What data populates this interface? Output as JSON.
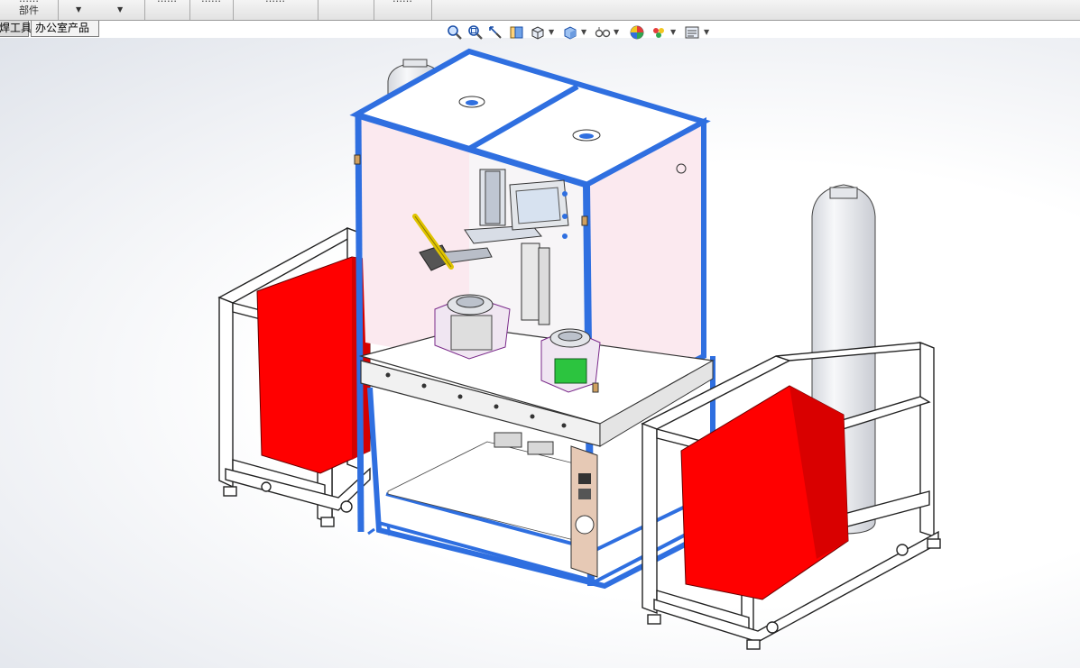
{
  "ribbon": {
    "assembly_label": "部件",
    "cut_labels": [
      "……",
      "……",
      "……",
      "……",
      "……"
    ]
  },
  "command_tabs": [
    {
      "label": "焊工具",
      "active": false
    },
    {
      "label": "办公室产品",
      "active": true
    }
  ],
  "heads_up_toolbar": [
    {
      "name": "zoom-to-fit-icon"
    },
    {
      "name": "zoom-to-area-icon"
    },
    {
      "name": "previous-view-icon"
    },
    {
      "name": "section-view-icon"
    },
    {
      "name": "view-orientation-icon",
      "dropdown": true
    },
    {
      "name": "display-style-icon",
      "dropdown": true
    },
    {
      "name": "hide-show-items-icon",
      "dropdown": true
    },
    {
      "name": "edit-appearance-icon",
      "dropdown": false
    },
    {
      "name": "apply-scene-icon",
      "dropdown": true
    },
    {
      "name": "view-settings-icon",
      "dropdown": true
    }
  ],
  "colors": {
    "frame_blue": "#2f6fe0",
    "panel_pink": "#fbe9ef",
    "bin_red": "#ff0000",
    "cart_white": "#ffffff",
    "gas_cylinder": "#e8eaee",
    "ribbon_bg": "#e8e8e8"
  }
}
